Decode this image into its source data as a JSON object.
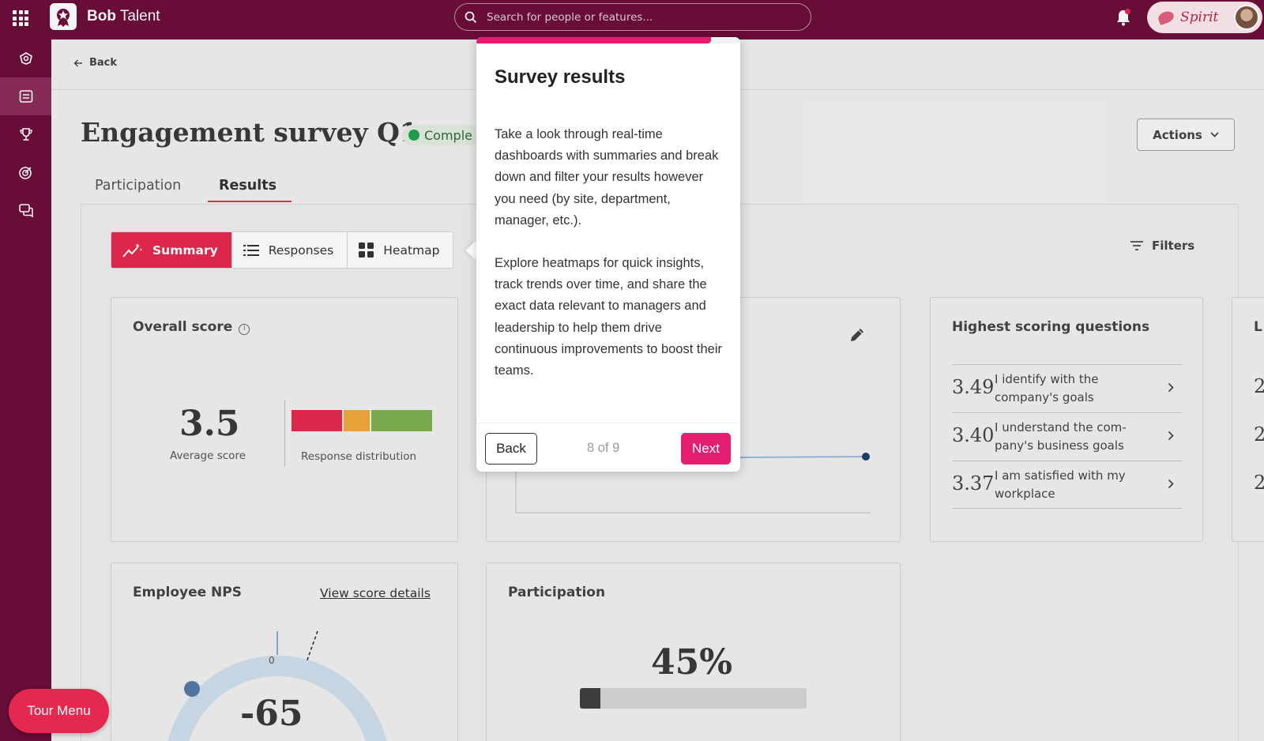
{
  "app": {
    "brand": "Bob",
    "product": "Talent"
  },
  "search": {
    "placeholder": "Search for people or features..."
  },
  "topbar": {
    "spirit_label": "Spirit",
    "icons": [
      "apps-grid-icon",
      "bell-icon",
      "avatar"
    ]
  },
  "sidebar": {
    "items": [
      "wellbeing-icon",
      "surveys-icon",
      "trophy-icon",
      "goals-icon",
      "chat-icon"
    ],
    "active_index": 1
  },
  "page": {
    "back_label": "Back",
    "title": "Engagement survey Q1",
    "status": "Comple",
    "actions_label": "Actions",
    "tabs": [
      {
        "label": "Participation"
      },
      {
        "label": "Results",
        "active": true
      }
    ],
    "views": [
      {
        "label": "Summary",
        "icon": "sparkline-icon",
        "active": true
      },
      {
        "label": "Responses",
        "icon": "list-icon"
      },
      {
        "label": "Heatmap",
        "icon": "grid-icon"
      }
    ],
    "filters_label": "Filters"
  },
  "overall": {
    "title": "Overall score",
    "score": "3.5",
    "score_caption": "Average score",
    "dist_caption": "Response distribution",
    "distribution": [
      {
        "share": 0.37,
        "color": "#e5284f"
      },
      {
        "share": 0.19,
        "color": "#f0a83c"
      },
      {
        "share": 0.44,
        "color": "#7fb04f"
      }
    ]
  },
  "highest": {
    "title": "Highest scoring questions",
    "questions": [
      {
        "score": "3.49",
        "text": "I identify with the company's goals"
      },
      {
        "score": "3.40",
        "text": "I understand the com- pany's business goals"
      },
      {
        "score": "3.37",
        "text": "I am satisfied with my workplace"
      }
    ]
  },
  "lowest": {
    "title_fragment": "L",
    "scores_fragment": [
      "2",
      "2",
      "2"
    ]
  },
  "nps": {
    "title": "Employee NPS",
    "details_link": "View score details",
    "zero_label": "0",
    "value": "-65"
  },
  "participation": {
    "title": "Participation",
    "value": "45%",
    "fraction": 0.09
  },
  "tour": {
    "title": "Survey results",
    "paragraphs": [
      "Take a look through real-time dashboards with summaries and break down and filter your results however you need (by site, department, manager, etc.).",
      "Explore heatmaps for quick insights, track trends over time, and share the exact data relevant to managers and leadership to help them drive continuous improvements to boost their teams."
    ],
    "back_label": "Back",
    "step_text": "8 of 9",
    "next_label": "Next",
    "progress": 0.89
  },
  "tour_menu_label": "Tour Menu",
  "colors": {
    "brand": "#6d0d3b",
    "accent": "#e5284f",
    "tour_accent": "#e31d70"
  }
}
